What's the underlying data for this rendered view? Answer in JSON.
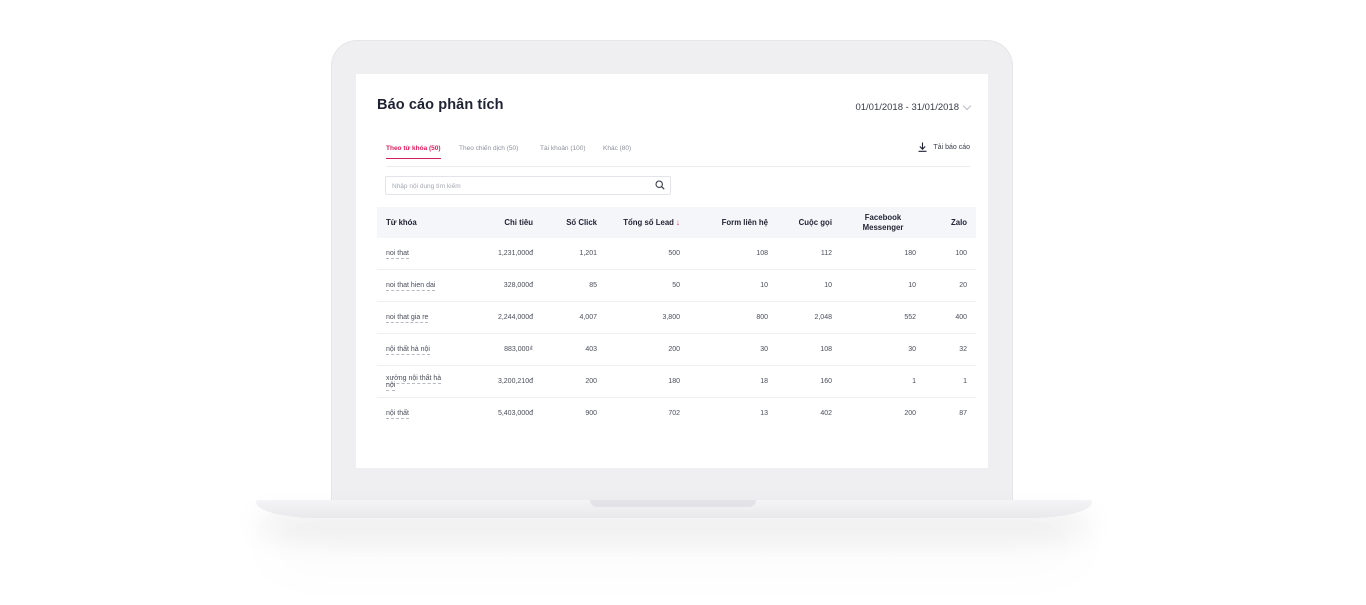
{
  "header": {
    "title": "Báo cáo phân tích",
    "date_range": "01/01/2018 - 31/01/2018"
  },
  "tabs": [
    {
      "label": "Theo từ khóa (50)",
      "active": true
    },
    {
      "label": "Theo chiến dịch (50)",
      "active": false
    },
    {
      "label": "Tài khoản (100)",
      "active": false
    },
    {
      "label": "Khác (80)",
      "active": false
    }
  ],
  "download_label": "Tải báo cáo",
  "search": {
    "placeholder": "Nhập nội dung tìm kiếm",
    "value": ""
  },
  "table": {
    "columns": {
      "keyword": "Từ khóa",
      "spend": "Chi tiêu",
      "clicks": "Số Click",
      "leads": "Tổng số Lead",
      "sort_indicator": "↓",
      "form": "Form liên hệ",
      "calls": "Cuộc gọi",
      "facebook_line1": "Facebook",
      "facebook_line2": "Messenger",
      "zalo": "Zalo"
    },
    "rows": [
      {
        "keyword": "noi that",
        "spend": "1,231,000đ",
        "clicks": "1,201",
        "leads": "500",
        "form": "108",
        "calls": "112",
        "facebook": "180",
        "zalo": "100"
      },
      {
        "keyword": "noi that hien dai",
        "spend": "328,000đ",
        "clicks": "85",
        "leads": "50",
        "form": "10",
        "calls": "10",
        "facebook": "10",
        "zalo": "20"
      },
      {
        "keyword": "noi that gia re",
        "spend": "2,244,000đ",
        "clicks": "4,007",
        "leads": "3,800",
        "form": "800",
        "calls": "2,048",
        "facebook": "552",
        "zalo": "400"
      },
      {
        "keyword": "nội thất hà nội",
        "spend": "883,000₫",
        "clicks": "403",
        "leads": "200",
        "form": "30",
        "calls": "108",
        "facebook": "30",
        "zalo": "32"
      },
      {
        "keyword": "xưởng nội thất hà nội",
        "spend": "3,200,210đ",
        "clicks": "200",
        "leads": "180",
        "form": "18",
        "calls": "160",
        "facebook": "1",
        "zalo": "1"
      },
      {
        "keyword": "nội thất",
        "spend": "5,403,000đ",
        "clicks": "900",
        "leads": "702",
        "form": "13",
        "calls": "402",
        "facebook": "200",
        "zalo": "87"
      }
    ]
  },
  "colors": {
    "accent": "#d81b5b",
    "header_bg": "#f5f6f9",
    "title_text": "#1f2233"
  },
  "icons": {
    "date_dropdown": "chevron-down-icon",
    "download": "download-icon",
    "search": "search-icon"
  }
}
